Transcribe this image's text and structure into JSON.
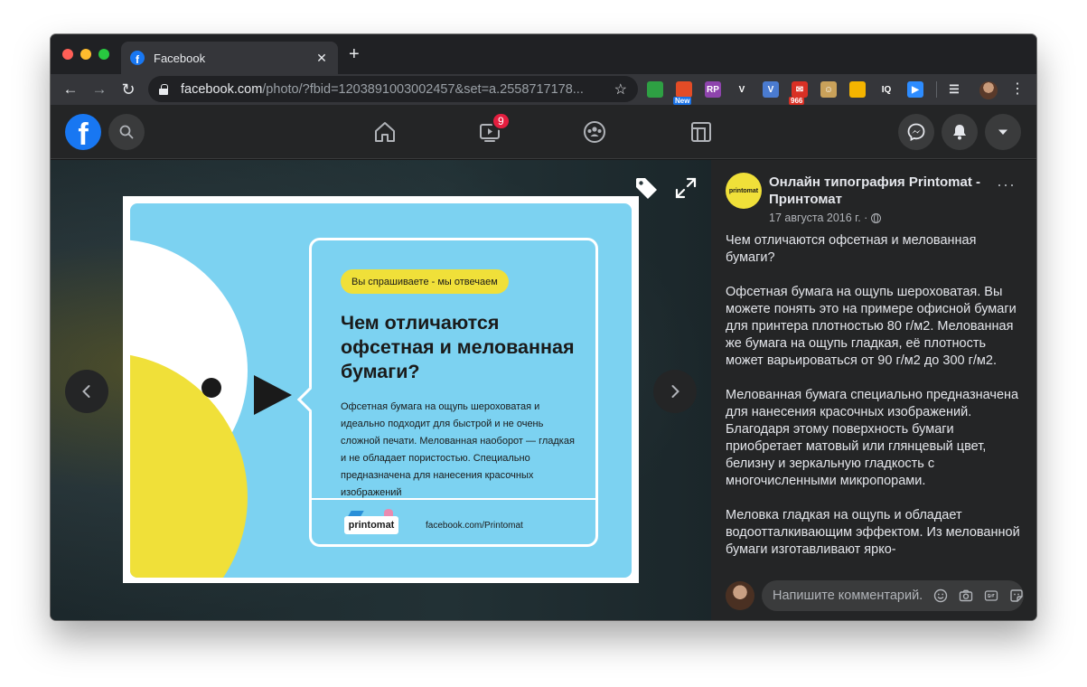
{
  "browser": {
    "tab_title": "Facebook",
    "tab_favicon": "f",
    "close_glyph": "✕",
    "new_tab_glyph": "+",
    "back_glyph": "←",
    "forward_glyph": "→",
    "reload_glyph": "↻",
    "url_host": "facebook.com",
    "url_path": "/photo/?fbid=1203891003002457&set=a.2558717178...",
    "star_glyph": "☆",
    "kebab_glyph": "⋮",
    "extensions": [
      {
        "icon": "screenshot-ext-icon",
        "label": "",
        "color": "#2ea043",
        "badge": ""
      },
      {
        "icon": "rainbow-ext-icon",
        "label": "",
        "color": "#e34c26",
        "badge": "New",
        "badge_color": "#1a73e8"
      },
      {
        "icon": "rp-ext-icon",
        "label": "RP",
        "color": "#8e44ad",
        "badge": ""
      },
      {
        "icon": "v-ext-icon",
        "label": "V",
        "color": "#35363a",
        "badge": ""
      },
      {
        "icon": "v-box-ext-icon",
        "label": "V",
        "color": "#4a7bd0",
        "badge": ""
      },
      {
        "icon": "mail-ext-icon",
        "label": "✉",
        "color": "#d93025",
        "badge": "966",
        "badge_color": "#d93025"
      },
      {
        "icon": "face-ext-icon",
        "label": "☺",
        "color": "#c9a15a",
        "badge": ""
      },
      {
        "icon": "flag-ext-icon",
        "label": "",
        "color": "#f4b400",
        "badge": ""
      },
      {
        "icon": "iq-ext-icon",
        "label": "IQ",
        "color": "#35363a",
        "badge": ""
      },
      {
        "icon": "zoom-ext-icon",
        "label": "▶",
        "color": "#2d8cff",
        "badge": ""
      }
    ]
  },
  "fb": {
    "logo_letter": "f",
    "watch_badge": "9"
  },
  "photo": {
    "pill": "Вы спрашиваете - мы отвечаем",
    "heading": "Чем отличаются офсетная и мелованная бумаги?",
    "body": "Офсетная бумага на ощупь шероховатая и идеально подходит для быстрой и не очень сложной печати. Мелованная наоборот — гладкая и не обладает пористостью. Специально предназначена для нанесения красочных изображений",
    "brand": "printomat",
    "link": "facebook.com/Printomat"
  },
  "post": {
    "page_name": "Онлайн типография Printomat - Принтомат",
    "avatar_text": "printomat",
    "date": "17 августа 2016 г. ·",
    "more_glyph": "···",
    "paragraphs": [
      "Чем отличаются офсетная и мелованная бумаги?",
      "Офсетная бумага на ощупь шероховатая. Вы можете понять это на примере офисной бумаги для принтера плотностью 80 г/м2. Мелованная же бумага на ощупь гладкая, её плотность может варьироваться от 90 г/м2 до 300 г/м2.",
      "Мелованная бумага специально предназначена для нанесения красочных изображений. Благодаря этому поверхность бумаги приобретает матовый или глянцевый цвет, белизну и зеркальную гладкость с многочисленными микропорами.",
      "Меловка гладкая на ощупь и обладает водоотталкивающим эффектом. Из мелованной бумаги изготавливают ярко-"
    ],
    "comment_placeholder": "Напишите комментарий..."
  }
}
